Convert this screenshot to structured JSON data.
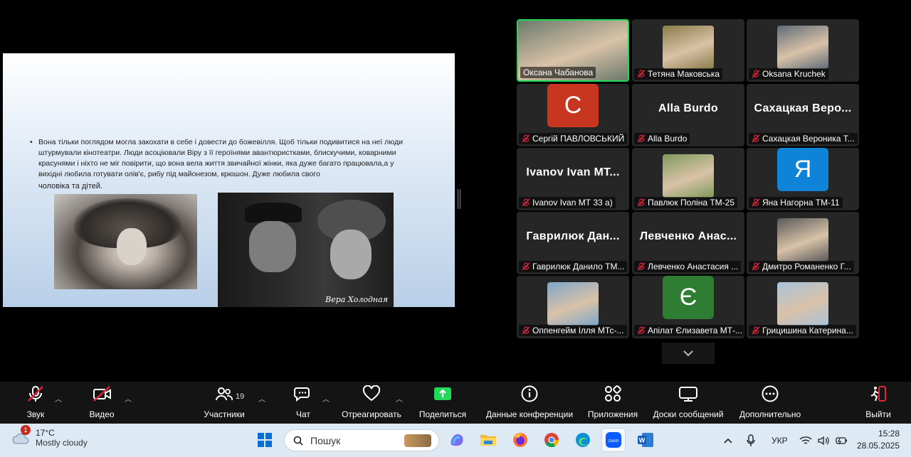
{
  "slide": {
    "paragraph": "Вона тільки поглядом могла закохати в себе і довести до божевілля. Щоб тільки подивитися на неї люди штурмували кінотеатри. Люди асоціювали Віру з її героїнями авантюристками, блискучими, коварними красунями і ніхто не міг повірити, що вона вела життя звичайної жінки, яка дуже багато працювала,а у вихідні любила готувати олів'є, рибу під майонезом, крюшон. Дуже любила свого",
    "paragraph_end": "чоловіка та дітей.",
    "photo_caption": "Вера Холодная"
  },
  "participants": [
    {
      "name": "Оксана Чабанова",
      "muted": false,
      "active": true,
      "display": "video",
      "bg": "#6b7a6a"
    },
    {
      "name": "Тетяна Маковська",
      "muted": true,
      "display": "video",
      "bg": "#8a7c4a"
    },
    {
      "name": "Oksana Kruchek",
      "muted": true,
      "display": "video",
      "bg": "#5f6b78"
    },
    {
      "name": "Сергій ПАВЛОВСЬКИЙ",
      "muted": true,
      "display": "letter",
      "letter": "С",
      "bg": "#c8361f"
    },
    {
      "name": "Alla Burdo",
      "muted": true,
      "display": "name",
      "big": "Alla Burdo"
    },
    {
      "name": "Сахацкая Вероника Т...",
      "muted": true,
      "display": "name",
      "big": "Сахацкая Веро..."
    },
    {
      "name": "Ivanov Ivan МТ 33 а)",
      "muted": true,
      "display": "name",
      "big": "Ivanov Ivan МТ..."
    },
    {
      "name": "Павлюк Поліна ТМ-25",
      "muted": true,
      "display": "video",
      "bg": "#7f9a5a"
    },
    {
      "name": "Яна Нагорна ТМ-11",
      "muted": true,
      "display": "letter",
      "letter": "Я",
      "bg": "#0e83d8"
    },
    {
      "name": "Гаврилюк Данило ТМ...",
      "muted": true,
      "display": "name",
      "big": "Гаврилюк Дан..."
    },
    {
      "name": "Левченко Анастасия ...",
      "muted": true,
      "display": "name",
      "big": "Левченко Анас..."
    },
    {
      "name": "Дмитро Романенко Г...",
      "muted": true,
      "display": "video",
      "bg": "#595959"
    },
    {
      "name": "Оппенгейм Ілля МТс-...",
      "muted": true,
      "display": "video",
      "bg": "#7fa6c9"
    },
    {
      "name": "Апілат Єлизавета МТ-...",
      "muted": true,
      "display": "letter",
      "letter": "Є",
      "bg": "#2e7d32"
    },
    {
      "name": "Грицишина Катерина...",
      "muted": true,
      "display": "video",
      "bg": "#a9c3d9"
    }
  ],
  "toolbar": {
    "audio": "Звук",
    "video": "Видео",
    "participants": "Участники",
    "participants_count": "19",
    "chat": "Чат",
    "react": "Отреагировать",
    "share": "Поделиться",
    "info": "Данные конференции",
    "apps": "Приложения",
    "whiteboards": "Доски сообщений",
    "more": "Дополнительно",
    "leave": "Выйти"
  },
  "taskbar": {
    "weather_temp": "17°C",
    "weather_desc": "Mostly cloudy",
    "weather_badge": "1",
    "search_placeholder": "Пошук",
    "language": "УКР",
    "time": "15:28",
    "date": "28.05.2025"
  },
  "colors": {
    "active_speaker": "#23d959",
    "muted_mic": "#e0243a",
    "share_green": "#23d959"
  }
}
